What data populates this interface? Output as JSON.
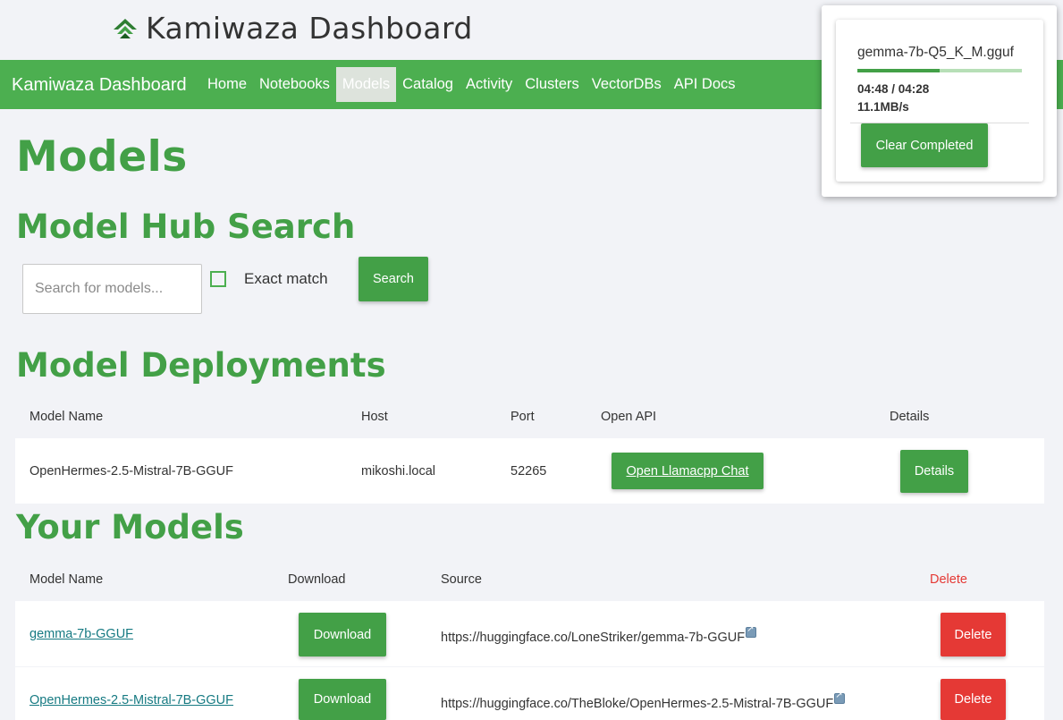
{
  "brand": {
    "title": "Kamiwaza Dashboard",
    "logo_icon": "kamiwaza-logo-icon"
  },
  "nav": {
    "brand": "Kamiwaza Dashboard",
    "links": [
      "Home",
      "Notebooks",
      "Models",
      "Catalog",
      "Activity",
      "Clusters",
      "VectorDBs",
      "API Docs"
    ],
    "active": "Models"
  },
  "page": {
    "title": "Models"
  },
  "hub_search": {
    "heading": "Model Hub Search",
    "placeholder": "Search for models...",
    "value": "",
    "exact_match_label": "Exact match",
    "exact_match_checked": false,
    "search_button": "Search"
  },
  "deployments": {
    "heading": "Model Deployments",
    "columns": [
      "Model Name",
      "Host",
      "Port",
      "Open API",
      "Details"
    ],
    "rows": [
      {
        "model_name": "OpenHermes-2.5-Mistral-7B-GGUF",
        "host": "mikoshi.local",
        "port": "52265",
        "open_api": "Open Llamacpp Chat",
        "details": "Details"
      }
    ]
  },
  "your_models": {
    "heading": "Your Models",
    "columns": [
      "Model Name",
      "Download",
      "Source",
      "Delete"
    ],
    "rows": [
      {
        "name": "gemma-7b-GGUF",
        "download": "Download",
        "source": "https://huggingface.co/LoneStriker/gemma-7b-GGUF",
        "delete": "Delete"
      },
      {
        "name": "OpenHermes-2.5-Mistral-7B-GGUF",
        "download": "Download",
        "source": "https://huggingface.co/TheBloke/OpenHermes-2.5-Mistral-7B-GGUF",
        "delete": "Delete"
      }
    ]
  },
  "download_popup": {
    "filename": "gemma-7b-Q5_K_M.gguf",
    "progress_fraction": 0.5,
    "time": "04:48 / 04:28",
    "speed": "11.1MB/s",
    "clear_button": "Clear Completed"
  },
  "colors": {
    "primary": "#4caf50",
    "heading": "#43a047",
    "danger": "#e53935",
    "link": "#167a82"
  }
}
